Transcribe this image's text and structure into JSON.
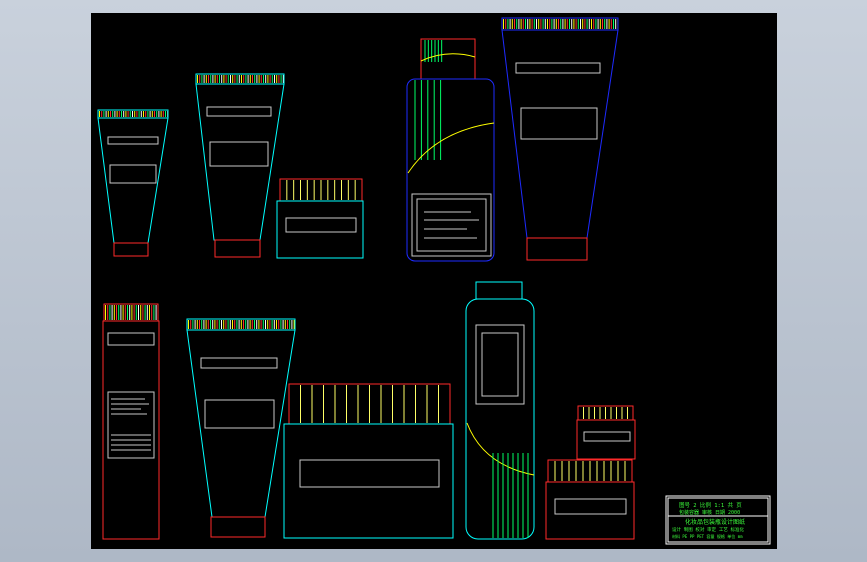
{
  "viewport": {
    "background": "#b4bdc9",
    "canvas_background": "#000000"
  },
  "palette": {
    "tube_body": "#00ffff",
    "tube_cap": "#ff2a2a",
    "crimp_stripes": [
      "#ffff00",
      "#ff3030",
      "#00ff66",
      "#ffffff"
    ],
    "label": "#c8c8c8",
    "bottle_outline": "#1e2bff",
    "bottle_accent": "#ffff00",
    "jar_lid_stripes": "#ffff66",
    "title_block": "#3cff3c",
    "title_block_border": "#ffffff"
  },
  "title_block": {
    "lines": [
      "图号 2   比例 1:1  共 页",
      "包装容器     审核  日期 2000",
      "化妆品包装瓶设计图纸",
      "设计 制图 校对 审定 工艺 标准化",
      "材料 PE PP PET 容量 规格 单位 mm"
    ]
  }
}
